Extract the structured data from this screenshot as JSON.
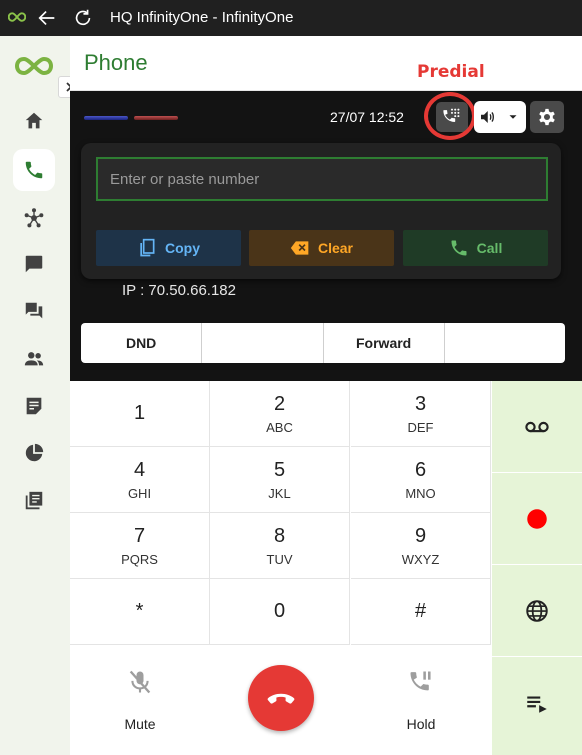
{
  "window": {
    "title": "HQ InfinityOne - InfinityOne"
  },
  "header": {
    "page_title": "Phone"
  },
  "annotation": {
    "label": "Predial"
  },
  "status": {
    "datetime": "27/07  12:52",
    "ip": "IP : 70.50.66.182"
  },
  "dial": {
    "placeholder": "Enter or paste number",
    "value": ""
  },
  "actions": {
    "copy": "Copy",
    "clear": "Clear",
    "call": "Call"
  },
  "toggles": [
    "DND",
    "",
    "Forward",
    ""
  ],
  "keypad": [
    {
      "digit": "1",
      "letters": ""
    },
    {
      "digit": "2",
      "letters": "ABC"
    },
    {
      "digit": "3",
      "letters": "DEF"
    },
    {
      "digit": "4",
      "letters": "GHI"
    },
    {
      "digit": "5",
      "letters": "JKL"
    },
    {
      "digit": "6",
      "letters": "MNO"
    },
    {
      "digit": "7",
      "letters": "PQRS"
    },
    {
      "digit": "8",
      "letters": "TUV"
    },
    {
      "digit": "9",
      "letters": "WXYZ"
    },
    {
      "digit": "*",
      "letters": ""
    },
    {
      "digit": "0",
      "letters": ""
    },
    {
      "digit": "#",
      "letters": ""
    }
  ],
  "controls": {
    "mute": "Mute",
    "hold": "Hold"
  },
  "icons": {
    "sidebar": [
      "home-icon",
      "phone-icon",
      "hub-icon",
      "chat-icon",
      "forum-icon",
      "people-icon",
      "notes-icon",
      "pie-chart-icon",
      "library-icon"
    ],
    "side_actions": [
      "voicemail-icon",
      "record-icon",
      "globe-icon",
      "playlist-icon"
    ]
  },
  "colors": {
    "brand_green": "#2e7d32",
    "annotation_red": "#e53935",
    "record_red": "#ff0000",
    "side_panel": "#e6f4d7"
  }
}
